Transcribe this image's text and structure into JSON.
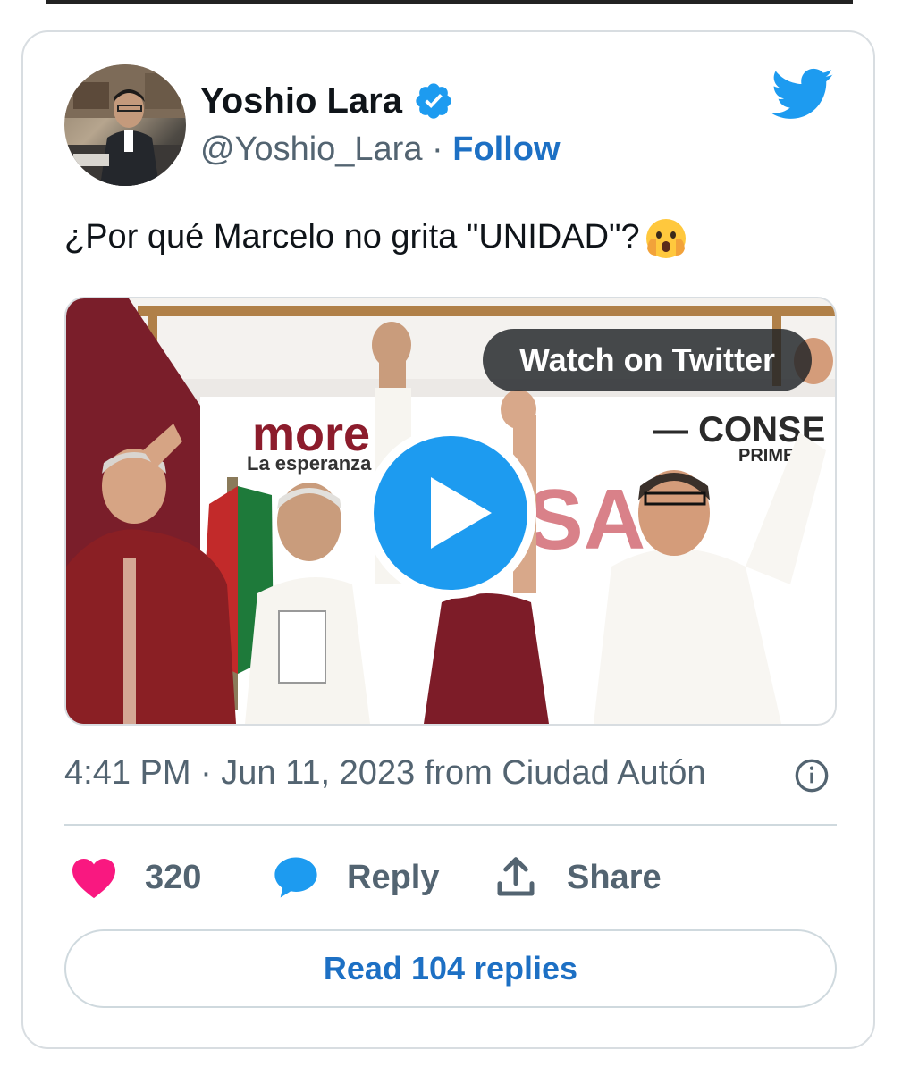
{
  "tweet": {
    "author": {
      "display_name": "Yoshio Lara",
      "handle": "@Yoshio_Lara",
      "separator": " · ",
      "follow_label": "Follow",
      "verified": true
    },
    "text": "¿Por qué Marcelo no grita \"UNIDAD\"?",
    "media": {
      "watch_label": "Watch on Twitter",
      "banner_brand": "more",
      "banner_tagline": "La esperanza d",
      "banner_right": "— CONSE",
      "banner_right_sub": "PRIMERA"
    },
    "timestamp": "4:41 PM · Jun 11, 2023 from Ciudad Autón",
    "actions": {
      "likes": "320",
      "reply_label": "Reply",
      "share_label": "Share"
    },
    "read_replies_label": "Read 104 replies"
  },
  "colors": {
    "accent": "#1d9bf0",
    "link": "#1d70c4",
    "like": "#f91880",
    "muted": "#536471"
  },
  "icons": [
    "twitter-bird-icon",
    "verified-badge-icon",
    "face-with-hand-over-mouth-emoji",
    "play-icon",
    "info-icon",
    "heart-icon",
    "reply-bubble-icon",
    "share-icon"
  ]
}
